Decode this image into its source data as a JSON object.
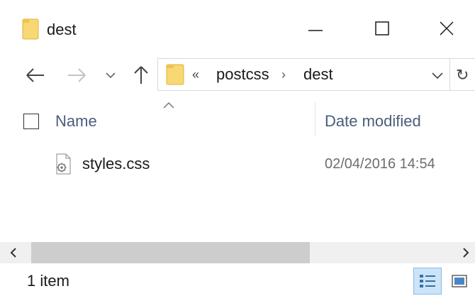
{
  "window": {
    "title": "dest"
  },
  "address": {
    "overflow": "«",
    "crumbs": [
      "postcss",
      "dest"
    ],
    "separator": "›"
  },
  "columns": {
    "name": "Name",
    "date": "Date modified"
  },
  "files": [
    {
      "name": "styles.css",
      "date": "02/04/2016 14:54",
      "icon": "css-file-icon"
    }
  ],
  "status": {
    "count": "1 item"
  },
  "icons": {
    "folder": "folder-icon",
    "back": "arrow-left-icon",
    "forward": "arrow-right-icon",
    "recent": "chevron-down-icon",
    "up": "arrow-up-icon",
    "refresh": "refresh-icon",
    "sort": "sort-ascending-icon"
  },
  "colors": {
    "folder": "#f8d775",
    "column_header": "#4a5d79",
    "date_text": "#6d6d6d",
    "selected_view": "#cce4f7"
  },
  "scrollbar": {
    "position": 0,
    "thumb_fraction": 0.59
  },
  "view": {
    "selected": "details"
  }
}
